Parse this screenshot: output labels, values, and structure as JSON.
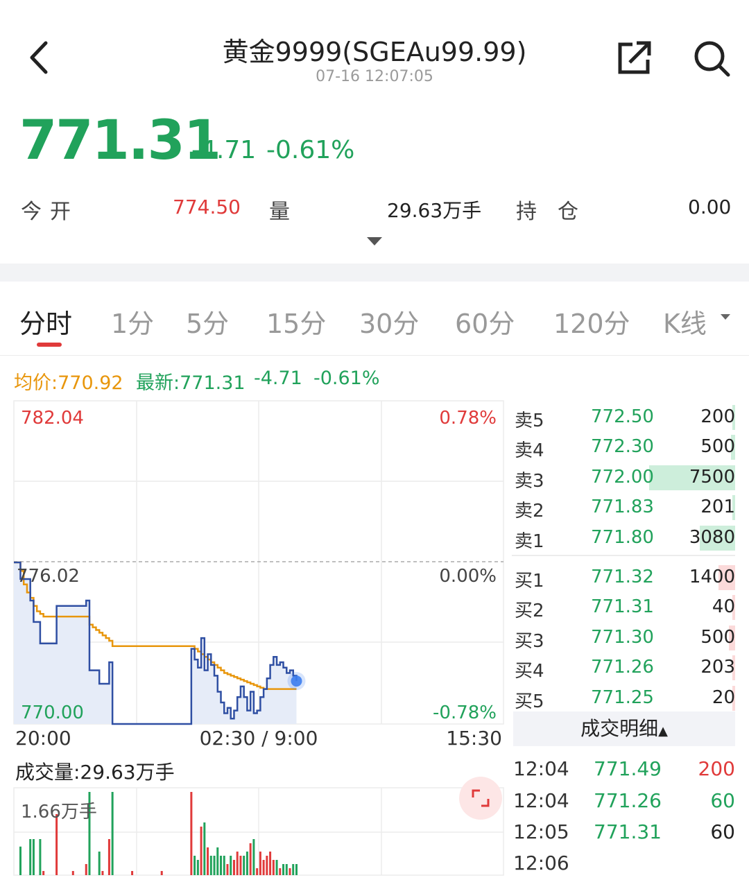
{
  "header": {
    "title": "黄金9999(SGEAu99.99)",
    "timestamp": "07-16 12:07:05"
  },
  "quote": {
    "price": "771.31",
    "change": "-4.71",
    "change_pct": "-0.61%",
    "stats": [
      {
        "label": "今开",
        "value": "774.50",
        "color": "#e03a3a"
      },
      {
        "label": "量",
        "value": "29.63万手",
        "color": "#222222"
      },
      {
        "label": "持仓",
        "value": "0.00",
        "color": "#222222"
      }
    ]
  },
  "tabs": [
    "分时",
    "1分",
    "5分",
    "15分",
    "30分",
    "60分",
    "120分",
    "K线"
  ],
  "active_tab": 0,
  "legend": {
    "avg_price": "均价:770.92",
    "latest": "最新:771.31",
    "change": "-4.71",
    "change_pct": "-0.61%"
  },
  "chart_data": {
    "type": "line",
    "y_top_label": "782.04",
    "y_mid_label": "776.02",
    "y_bottom_label": "770.00",
    "pct_top_label": "0.78%",
    "pct_mid_label": "0.00%",
    "pct_bottom_label": "-0.78%",
    "x_labels": [
      "20:00",
      "02:30 / 9:00",
      "15:30"
    ],
    "ylim": [
      770.0,
      782.04
    ],
    "prev_close": 776.02,
    "series": [
      {
        "values": [
          776.02,
          776.02,
          775.4,
          775.4,
          775.4,
          774.6,
          773.8,
          773.8,
          773.0,
          773.0,
          773.0,
          773.0,
          773.0,
          774.4,
          774.4,
          774.4,
          774.4,
          774.4,
          774.4,
          774.4,
          774.4,
          774.4,
          774.6,
          772.0,
          772.0,
          772.0,
          771.5,
          771.5,
          771.5,
          772.3,
          770.0,
          770.0,
          770.0,
          770.0,
          770.0,
          770.0,
          770.0,
          770.0,
          770.0,
          770.0,
          770.0,
          770.0,
          770.0,
          770.0,
          770.0,
          770.0,
          770.0,
          770.0,
          770.0,
          770.0,
          770.0,
          770.0,
          770.0,
          770.0,
          772.8,
          772.4,
          772.1,
          773.2,
          772.0,
          772.6,
          772.2,
          771.8,
          771.2,
          770.8,
          770.4,
          770.6,
          770.2,
          770.5,
          771.0,
          771.4,
          771.0,
          770.5,
          771.2,
          770.4,
          770.5,
          771.0,
          771.3,
          771.7,
          772.2,
          772.5,
          772.2,
          772.3,
          772.1,
          771.9,
          772.0,
          771.8,
          771.6
        ]
      },
      {
        "values": [
          776.02,
          776.02,
          775.7,
          775.2,
          774.9,
          774.7,
          774.4,
          774.2,
          774.1,
          774.0,
          774.0,
          774.0,
          774.0,
          774.0,
          774.0,
          774.0,
          774.0,
          774.0,
          774.0,
          774.0,
          774.0,
          774.0,
          774.0,
          773.7,
          773.6,
          773.5,
          773.4,
          773.3,
          773.2,
          773.1,
          772.9,
          772.9,
          772.9,
          772.9,
          772.9,
          772.9,
          772.9,
          772.9,
          772.9,
          772.9,
          772.9,
          772.9,
          772.9,
          772.9,
          772.9,
          772.9,
          772.9,
          772.9,
          772.9,
          772.9,
          772.9,
          772.9,
          772.9,
          772.9,
          772.9,
          772.8,
          772.7,
          772.6,
          772.5,
          772.4,
          772.3,
          772.2,
          772.1,
          772.0,
          771.9,
          771.85,
          771.8,
          771.75,
          771.7,
          771.65,
          771.6,
          771.55,
          771.5,
          771.45,
          771.4,
          771.35,
          771.3,
          771.3,
          771.3,
          771.3,
          771.3,
          771.3,
          771.3,
          771.3,
          771.3,
          771.3,
          771.3
        ]
      }
    ]
  },
  "order_book": {
    "sells": [
      {
        "label": "卖5",
        "price": "772.50",
        "vol": "200",
        "bar": 0.02
      },
      {
        "label": "卖4",
        "price": "772.30",
        "vol": "500",
        "bar": 0.05
      },
      {
        "label": "卖3",
        "price": "772.00",
        "vol": "7500",
        "bar": 1.0
      },
      {
        "label": "卖2",
        "price": "771.83",
        "vol": "201",
        "bar": 0.02
      },
      {
        "label": "卖1",
        "price": "771.80",
        "vol": "3080",
        "bar": 0.41
      }
    ],
    "buys": [
      {
        "label": "买1",
        "price": "771.32",
        "vol": "1400",
        "bar": 0.19
      },
      {
        "label": "买2",
        "price": "771.31",
        "vol": "40",
        "bar": 0.01
      },
      {
        "label": "买3",
        "price": "771.30",
        "vol": "500",
        "bar": 0.07
      },
      {
        "label": "买4",
        "price": "771.26",
        "vol": "203",
        "bar": 0.03
      },
      {
        "label": "买5",
        "price": "771.25",
        "vol": "20",
        "bar": 0.01
      }
    ]
  },
  "trade_detail": {
    "header": "成交明细",
    "rows": [
      {
        "time": "12:04",
        "price": "771.49",
        "vol": "200",
        "color": "#e03a3a"
      },
      {
        "time": "12:04",
        "price": "771.26",
        "vol": "60",
        "color": "#21a25b"
      },
      {
        "time": "12:05",
        "price": "771.31",
        "vol": "60",
        "color": "#222222"
      },
      {
        "time": "12:06",
        "price": "",
        "vol": "",
        "color": "#222222"
      }
    ]
  },
  "volume": {
    "title": "成交量:29.63万手",
    "max_label": "1.66万手"
  },
  "colors": {
    "up": "#e03a3a",
    "down": "#21a25b",
    "price_line": "#2f4fa3",
    "avg_line": "#e8960c",
    "fill": "#e6ecf8"
  }
}
